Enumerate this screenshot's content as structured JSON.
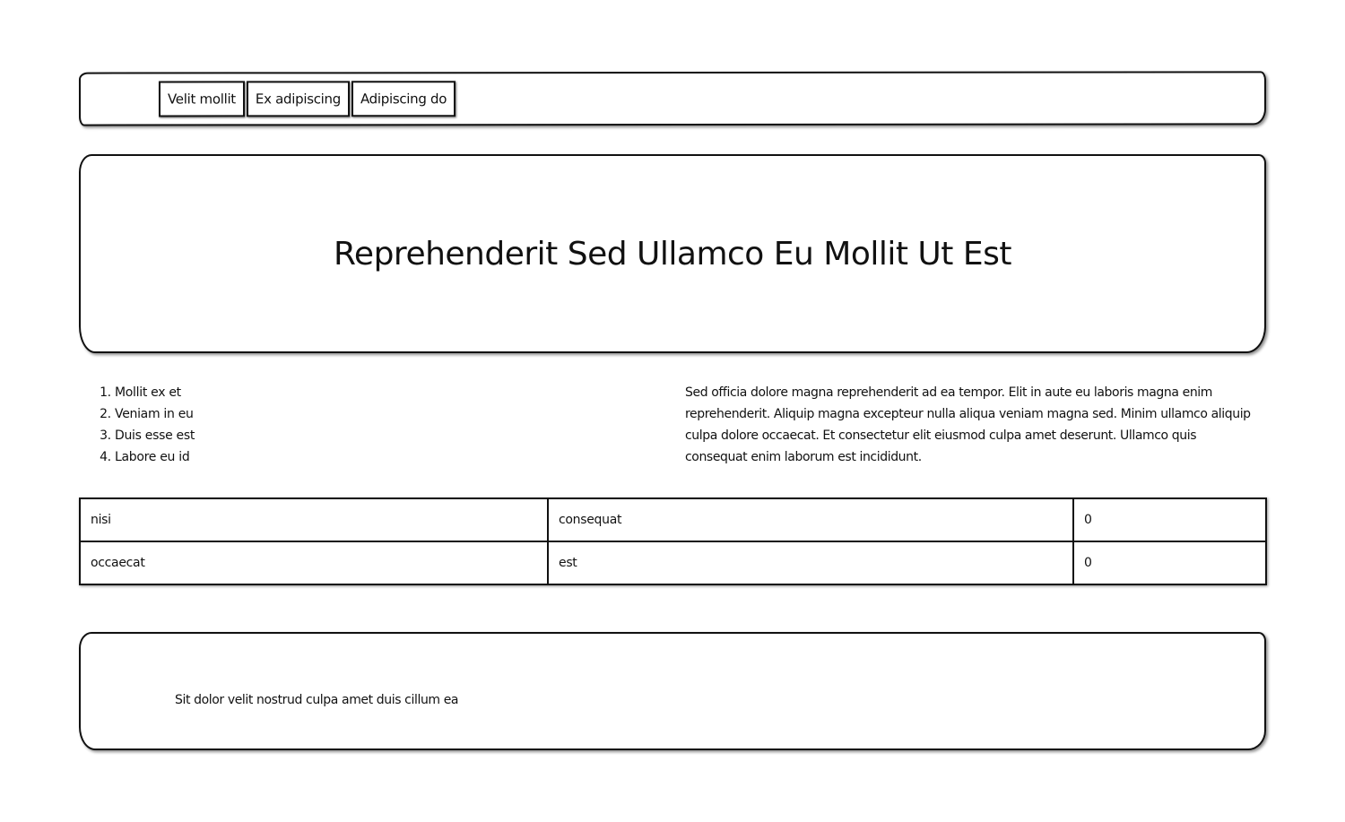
{
  "nav": {
    "buttons": [
      "Velit mollit",
      "Ex adipiscing",
      "Adipiscing do"
    ]
  },
  "hero": {
    "title": "Reprehenderit Sed Ullamco Eu Mollit Ut Est"
  },
  "list": {
    "items": [
      "Mollit ex et",
      "Veniam in eu",
      "Duis esse est",
      "Labore eu id"
    ]
  },
  "paragraph": {
    "text": "Sed officia dolore magna reprehenderit ad ea tempor. Elit in aute eu laboris magna enim reprehenderit. Aliquip magna excepteur nulla aliqua veniam magna sed. Minim ullamco aliquip culpa dolore occaecat. Et consectetur elit eiusmod culpa amet deserunt. Ullamco quis consequat enim laborum est incididunt."
  },
  "table": {
    "rows": [
      [
        "nisi",
        "consequat",
        "0"
      ],
      [
        "occaecat",
        "est",
        "0"
      ]
    ]
  },
  "footer": {
    "text": "Sit dolor velit nostrud culpa amet duis cillum ea"
  }
}
